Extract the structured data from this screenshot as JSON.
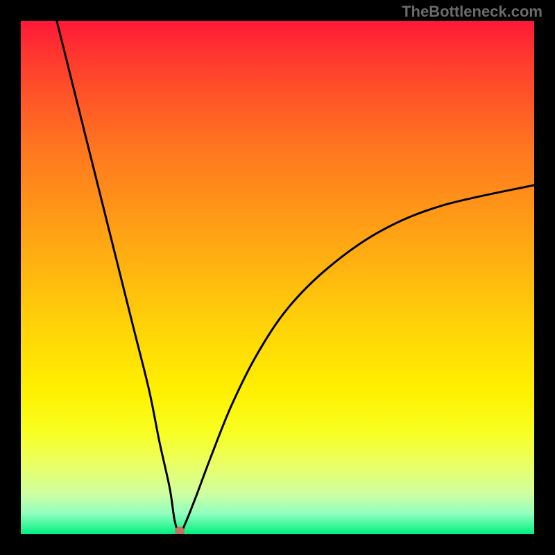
{
  "watermark": "TheBottleneck.com",
  "chart_data": {
    "type": "line",
    "title": "",
    "xlabel": "",
    "ylabel": "",
    "xlim": [
      0,
      100
    ],
    "ylim": [
      0,
      100
    ],
    "gradient_stops": [
      {
        "pos": 0,
        "color": "#ff1838"
      },
      {
        "pos": 6,
        "color": "#ff3430"
      },
      {
        "pos": 14,
        "color": "#ff5228"
      },
      {
        "pos": 24,
        "color": "#ff7420"
      },
      {
        "pos": 36,
        "color": "#ff9418"
      },
      {
        "pos": 48,
        "color": "#ffb410"
      },
      {
        "pos": 60,
        "color": "#ffd408"
      },
      {
        "pos": 72,
        "color": "#fff000"
      },
      {
        "pos": 80,
        "color": "#f8ff20"
      },
      {
        "pos": 86,
        "color": "#ecff60"
      },
      {
        "pos": 92,
        "color": "#d0ffa0"
      },
      {
        "pos": 96,
        "color": "#90ffc0"
      },
      {
        "pos": 100,
        "color": "#00f080"
      }
    ],
    "series": [
      {
        "name": "bottleneck-curve",
        "x": [
          7,
          10,
          13,
          16,
          19,
          22,
          25,
          27,
          29,
          30,
          31,
          32,
          34,
          37,
          41,
          46,
          52,
          60,
          70,
          82,
          100
        ],
        "y": [
          100,
          88,
          76,
          64,
          52,
          40,
          28,
          18,
          9,
          2.5,
          0.2,
          2,
          7,
          15,
          25,
          35,
          44,
          52,
          59,
          64,
          68
        ]
      }
    ],
    "marker": {
      "x": 31,
      "y": 0.6
    }
  }
}
